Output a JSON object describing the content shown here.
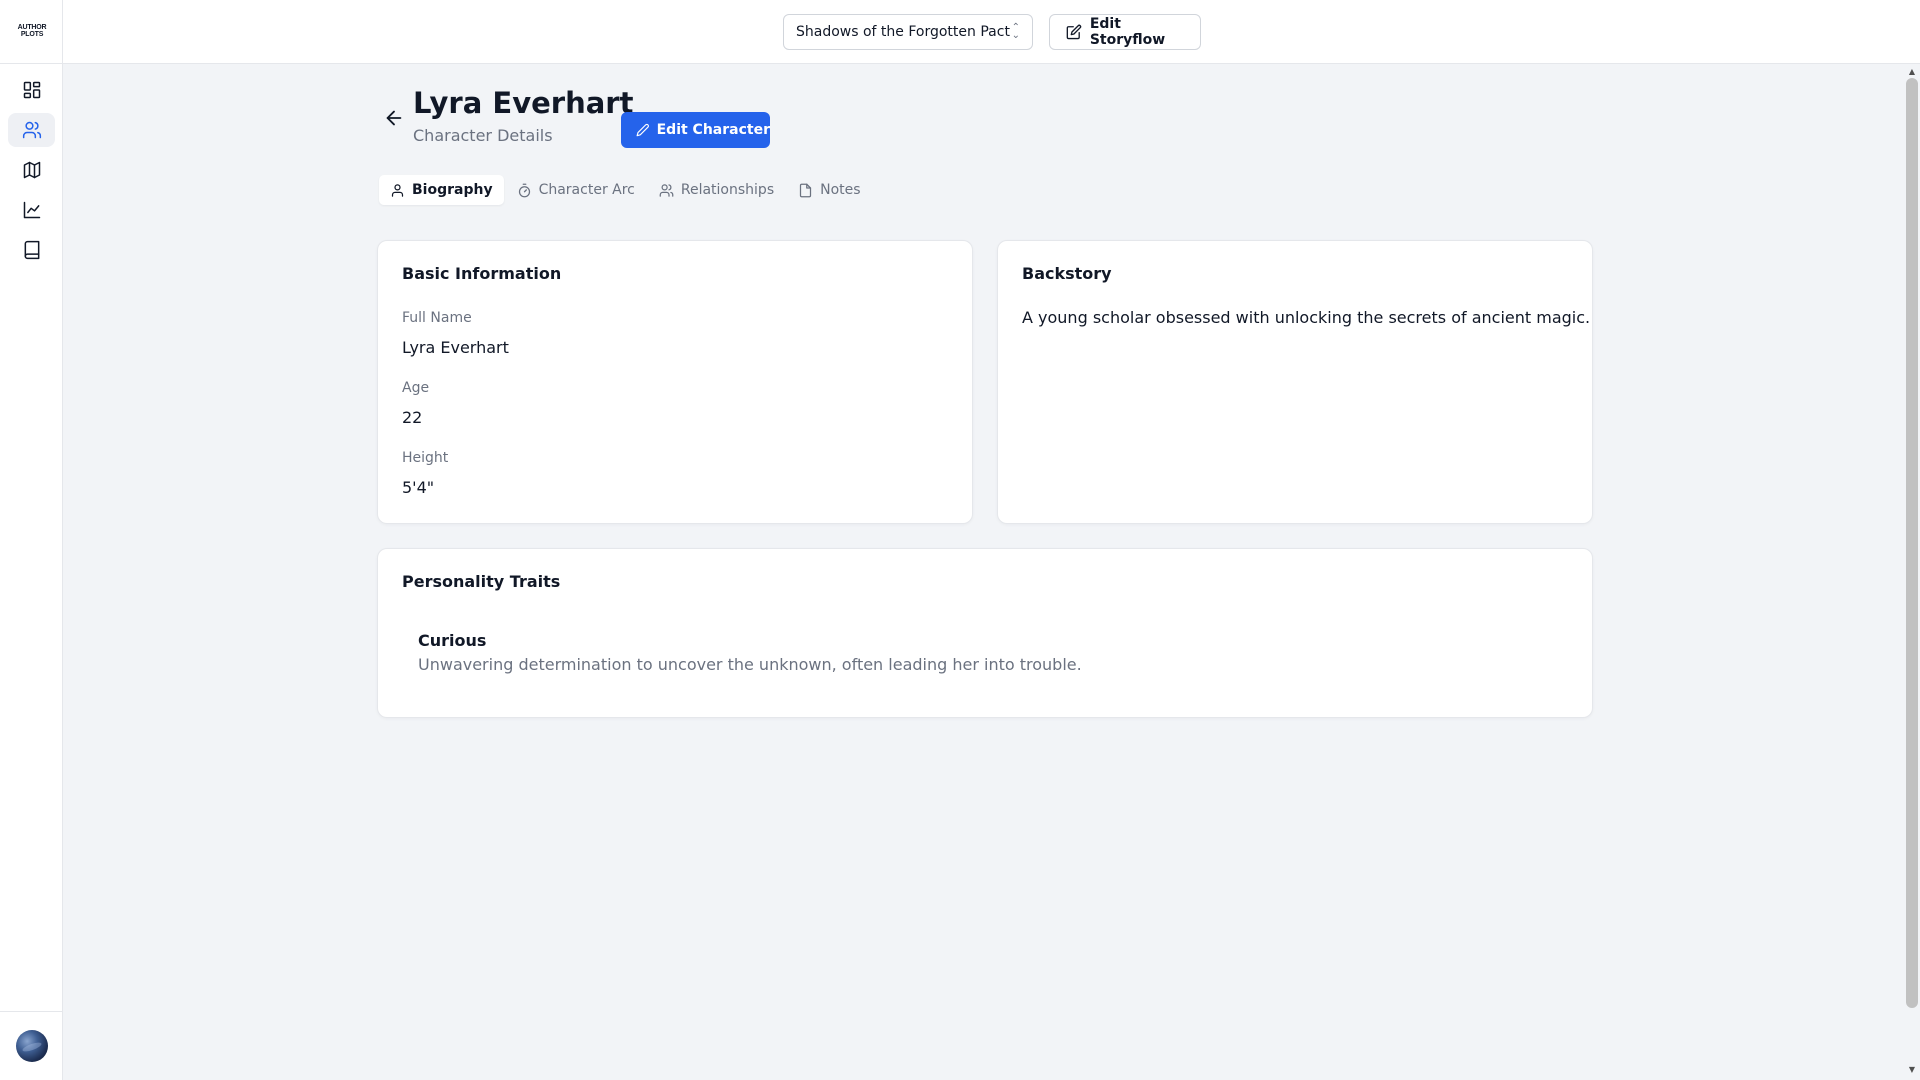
{
  "app": {
    "logo_text_line1": "AUTHOR",
    "logo_text_line2": "PLOTS"
  },
  "sidebar": {
    "items": [
      {
        "icon": "dashboard-icon",
        "active": false
      },
      {
        "icon": "users-icon",
        "active": true
      },
      {
        "icon": "map-icon",
        "active": false
      },
      {
        "icon": "chart-icon",
        "active": false
      },
      {
        "icon": "book-icon",
        "active": false
      }
    ]
  },
  "topbar": {
    "story_select": {
      "value": "Shadows of the Forgotten Pact"
    },
    "edit_storyflow_label": "Edit Storyflow"
  },
  "header": {
    "name": "Lyra Everhart",
    "subtitle": "Character Details",
    "edit_character_label": "Edit Character"
  },
  "tabs": [
    {
      "label": "Biography",
      "icon": "user-icon",
      "active": true
    },
    {
      "label": "Character Arc",
      "icon": "timer-icon",
      "active": false
    },
    {
      "label": "Relationships",
      "icon": "users-icon",
      "active": false
    },
    {
      "label": "Notes",
      "icon": "file-icon",
      "active": false
    }
  ],
  "basic_info": {
    "title": "Basic Information",
    "fields": [
      {
        "label": "Full Name",
        "value": "Lyra Everhart"
      },
      {
        "label": "Age",
        "value": "22"
      },
      {
        "label": "Height",
        "value": "5'4\""
      }
    ]
  },
  "backstory": {
    "title": "Backstory",
    "text": "A young scholar obsessed with unlocking the secrets of ancient magic."
  },
  "personality": {
    "title": "Personality Traits",
    "traits": [
      {
        "name": "Curious",
        "description": "Unwavering determination to uncover the unknown, often leading her into trouble."
      }
    ]
  },
  "colors": {
    "accent": "#2563eb",
    "background": "#f2f4f7"
  }
}
